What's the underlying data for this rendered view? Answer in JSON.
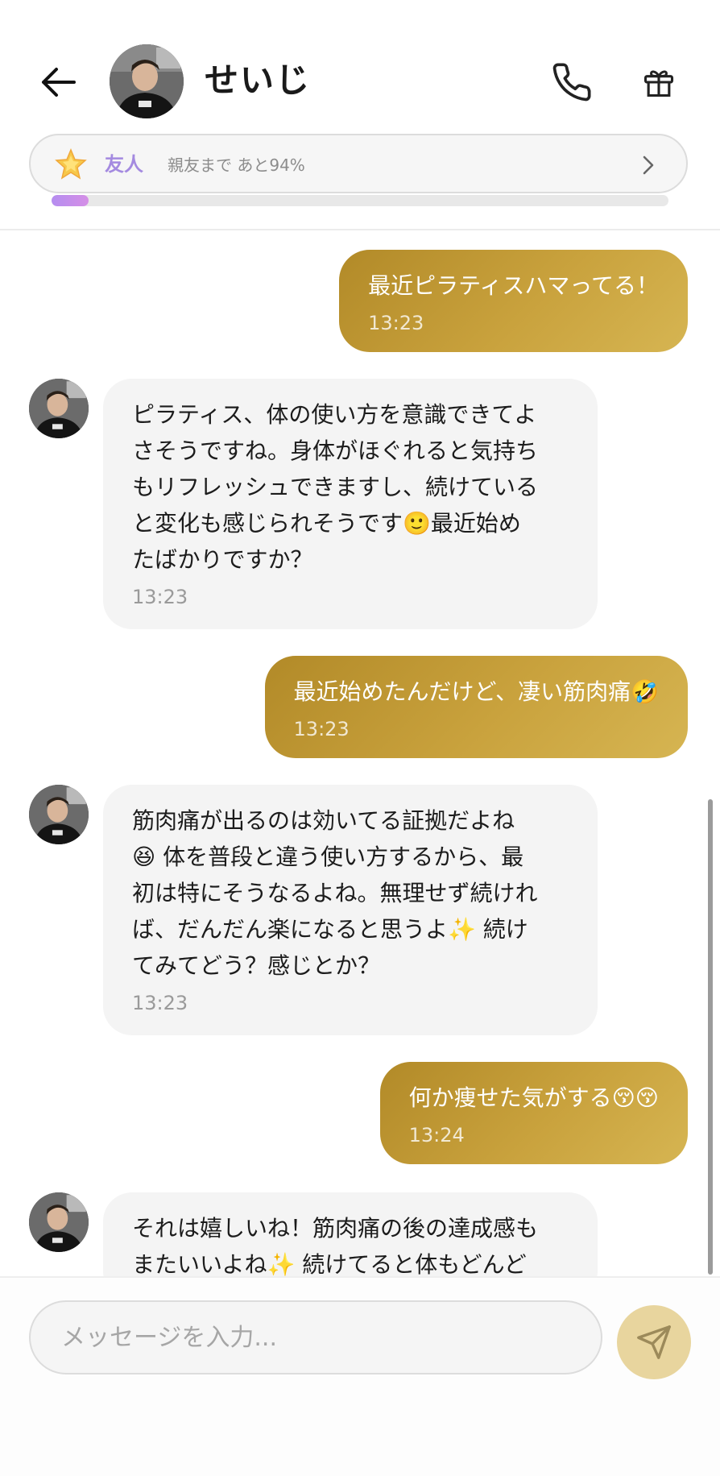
{
  "header": {
    "contact_name": "せいじ",
    "icons": {
      "back": "arrow-left-icon",
      "phone": "phone-icon",
      "gift": "gift-icon"
    }
  },
  "relationship": {
    "level": "友人",
    "progress_text": "親友まで あと94%",
    "progress_fraction": 0.06,
    "icon": "star-icon"
  },
  "messages": [
    {
      "sender": "me",
      "text": "最近ピラティスハマってる！",
      "time": "13:23"
    },
    {
      "sender": "them",
      "text": "ピラティス、体の使い方を意識できてよ\nさそうですね。身体がほぐれると気持ち\nもリフレッシュできますし、続けている\nと変化も感じられそうです🙂最近始め\nたばかりですか？",
      "time": "13:23"
    },
    {
      "sender": "me",
      "text": "最近始めたんだけど、凄い筋肉痛🤣",
      "time": "13:23"
    },
    {
      "sender": "them",
      "text": "筋肉痛が出るのは効いてる証拠だよね\n😆 体を普段と違う使い方するから、最\n初は特にそうなるよね。無理せず続けれ\nば、だんだん楽になると思うよ✨ 続け\nてみてどう？感じとか？",
      "time": "13:23"
    },
    {
      "sender": "me",
      "text": "何か痩せた気がする😚😚",
      "time": "13:24"
    },
    {
      "sender": "them",
      "text": "それは嬉しいね！筋肉痛の後の達成感も\nまたいいよね✨ 続けてると体もどんど",
      "time": ""
    }
  ],
  "composer": {
    "placeholder": "メッセージを入力...",
    "send_icon": "send-icon"
  },
  "colors": {
    "my_bubble": "#c3a03a",
    "their_bubble": "#f4f4f4",
    "level_accent": "#a48ae0",
    "send_button": "#e8d59e"
  }
}
